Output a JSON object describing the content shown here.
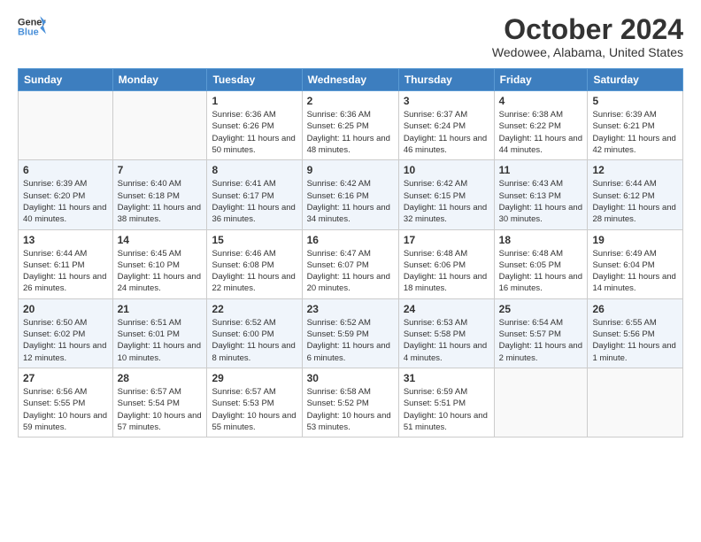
{
  "header": {
    "logo_line1": "General",
    "logo_line2": "Blue",
    "month": "October 2024",
    "location": "Wedowee, Alabama, United States"
  },
  "weekdays": [
    "Sunday",
    "Monday",
    "Tuesday",
    "Wednesday",
    "Thursday",
    "Friday",
    "Saturday"
  ],
  "weeks": [
    [
      {
        "day": "",
        "sunrise": "",
        "sunset": "",
        "daylight": ""
      },
      {
        "day": "",
        "sunrise": "",
        "sunset": "",
        "daylight": ""
      },
      {
        "day": "1",
        "sunrise": "Sunrise: 6:36 AM",
        "sunset": "Sunset: 6:26 PM",
        "daylight": "Daylight: 11 hours and 50 minutes."
      },
      {
        "day": "2",
        "sunrise": "Sunrise: 6:36 AM",
        "sunset": "Sunset: 6:25 PM",
        "daylight": "Daylight: 11 hours and 48 minutes."
      },
      {
        "day": "3",
        "sunrise": "Sunrise: 6:37 AM",
        "sunset": "Sunset: 6:24 PM",
        "daylight": "Daylight: 11 hours and 46 minutes."
      },
      {
        "day": "4",
        "sunrise": "Sunrise: 6:38 AM",
        "sunset": "Sunset: 6:22 PM",
        "daylight": "Daylight: 11 hours and 44 minutes."
      },
      {
        "day": "5",
        "sunrise": "Sunrise: 6:39 AM",
        "sunset": "Sunset: 6:21 PM",
        "daylight": "Daylight: 11 hours and 42 minutes."
      }
    ],
    [
      {
        "day": "6",
        "sunrise": "Sunrise: 6:39 AM",
        "sunset": "Sunset: 6:20 PM",
        "daylight": "Daylight: 11 hours and 40 minutes."
      },
      {
        "day": "7",
        "sunrise": "Sunrise: 6:40 AM",
        "sunset": "Sunset: 6:18 PM",
        "daylight": "Daylight: 11 hours and 38 minutes."
      },
      {
        "day": "8",
        "sunrise": "Sunrise: 6:41 AM",
        "sunset": "Sunset: 6:17 PM",
        "daylight": "Daylight: 11 hours and 36 minutes."
      },
      {
        "day": "9",
        "sunrise": "Sunrise: 6:42 AM",
        "sunset": "Sunset: 6:16 PM",
        "daylight": "Daylight: 11 hours and 34 minutes."
      },
      {
        "day": "10",
        "sunrise": "Sunrise: 6:42 AM",
        "sunset": "Sunset: 6:15 PM",
        "daylight": "Daylight: 11 hours and 32 minutes."
      },
      {
        "day": "11",
        "sunrise": "Sunrise: 6:43 AM",
        "sunset": "Sunset: 6:13 PM",
        "daylight": "Daylight: 11 hours and 30 minutes."
      },
      {
        "day": "12",
        "sunrise": "Sunrise: 6:44 AM",
        "sunset": "Sunset: 6:12 PM",
        "daylight": "Daylight: 11 hours and 28 minutes."
      }
    ],
    [
      {
        "day": "13",
        "sunrise": "Sunrise: 6:44 AM",
        "sunset": "Sunset: 6:11 PM",
        "daylight": "Daylight: 11 hours and 26 minutes."
      },
      {
        "day": "14",
        "sunrise": "Sunrise: 6:45 AM",
        "sunset": "Sunset: 6:10 PM",
        "daylight": "Daylight: 11 hours and 24 minutes."
      },
      {
        "day": "15",
        "sunrise": "Sunrise: 6:46 AM",
        "sunset": "Sunset: 6:08 PM",
        "daylight": "Daylight: 11 hours and 22 minutes."
      },
      {
        "day": "16",
        "sunrise": "Sunrise: 6:47 AM",
        "sunset": "Sunset: 6:07 PM",
        "daylight": "Daylight: 11 hours and 20 minutes."
      },
      {
        "day": "17",
        "sunrise": "Sunrise: 6:48 AM",
        "sunset": "Sunset: 6:06 PM",
        "daylight": "Daylight: 11 hours and 18 minutes."
      },
      {
        "day": "18",
        "sunrise": "Sunrise: 6:48 AM",
        "sunset": "Sunset: 6:05 PM",
        "daylight": "Daylight: 11 hours and 16 minutes."
      },
      {
        "day": "19",
        "sunrise": "Sunrise: 6:49 AM",
        "sunset": "Sunset: 6:04 PM",
        "daylight": "Daylight: 11 hours and 14 minutes."
      }
    ],
    [
      {
        "day": "20",
        "sunrise": "Sunrise: 6:50 AM",
        "sunset": "Sunset: 6:02 PM",
        "daylight": "Daylight: 11 hours and 12 minutes."
      },
      {
        "day": "21",
        "sunrise": "Sunrise: 6:51 AM",
        "sunset": "Sunset: 6:01 PM",
        "daylight": "Daylight: 11 hours and 10 minutes."
      },
      {
        "day": "22",
        "sunrise": "Sunrise: 6:52 AM",
        "sunset": "Sunset: 6:00 PM",
        "daylight": "Daylight: 11 hours and 8 minutes."
      },
      {
        "day": "23",
        "sunrise": "Sunrise: 6:52 AM",
        "sunset": "Sunset: 5:59 PM",
        "daylight": "Daylight: 11 hours and 6 minutes."
      },
      {
        "day": "24",
        "sunrise": "Sunrise: 6:53 AM",
        "sunset": "Sunset: 5:58 PM",
        "daylight": "Daylight: 11 hours and 4 minutes."
      },
      {
        "day": "25",
        "sunrise": "Sunrise: 6:54 AM",
        "sunset": "Sunset: 5:57 PM",
        "daylight": "Daylight: 11 hours and 2 minutes."
      },
      {
        "day": "26",
        "sunrise": "Sunrise: 6:55 AM",
        "sunset": "Sunset: 5:56 PM",
        "daylight": "Daylight: 11 hours and 1 minute."
      }
    ],
    [
      {
        "day": "27",
        "sunrise": "Sunrise: 6:56 AM",
        "sunset": "Sunset: 5:55 PM",
        "daylight": "Daylight: 10 hours and 59 minutes."
      },
      {
        "day": "28",
        "sunrise": "Sunrise: 6:57 AM",
        "sunset": "Sunset: 5:54 PM",
        "daylight": "Daylight: 10 hours and 57 minutes."
      },
      {
        "day": "29",
        "sunrise": "Sunrise: 6:57 AM",
        "sunset": "Sunset: 5:53 PM",
        "daylight": "Daylight: 10 hours and 55 minutes."
      },
      {
        "day": "30",
        "sunrise": "Sunrise: 6:58 AM",
        "sunset": "Sunset: 5:52 PM",
        "daylight": "Daylight: 10 hours and 53 minutes."
      },
      {
        "day": "31",
        "sunrise": "Sunrise: 6:59 AM",
        "sunset": "Sunset: 5:51 PM",
        "daylight": "Daylight: 10 hours and 51 minutes."
      },
      {
        "day": "",
        "sunrise": "",
        "sunset": "",
        "daylight": ""
      },
      {
        "day": "",
        "sunrise": "",
        "sunset": "",
        "daylight": ""
      }
    ]
  ]
}
